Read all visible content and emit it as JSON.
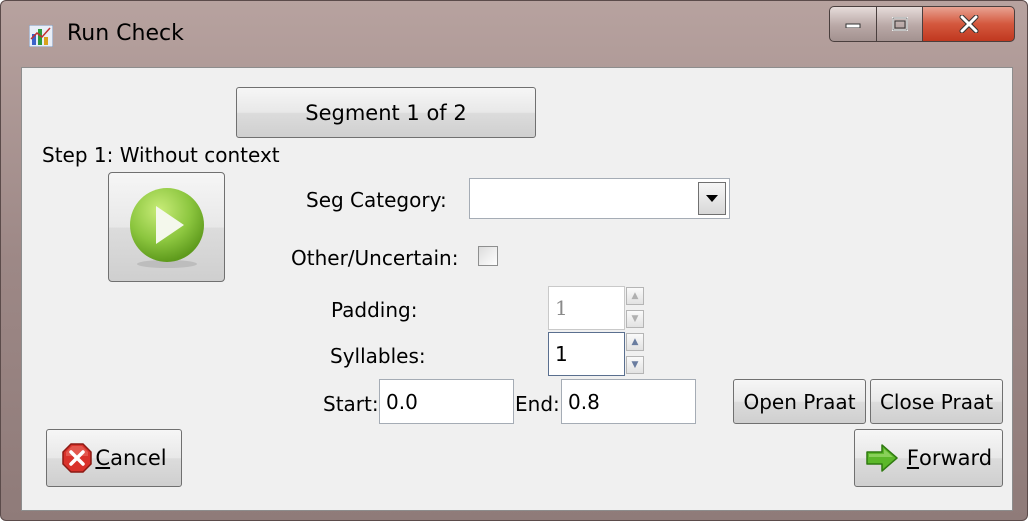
{
  "window": {
    "title": "Run Check"
  },
  "segment_button": {
    "label": "Segment 1 of 2"
  },
  "step_label": "Step 1: Without context",
  "form": {
    "seg_category_label": "Seg Category:",
    "seg_category_value": "",
    "other_uncertain_label": "Other/Uncertain:",
    "other_uncertain_checked": false,
    "padding_label": "Padding:",
    "padding_value": "1",
    "syllables_label": "Syllables:",
    "syllables_value": "1",
    "start_label": "Start:",
    "start_value": "0.0",
    "end_label": "End:",
    "end_value": "0.8"
  },
  "buttons": {
    "open_praat": "Open Praat",
    "close_praat": "Close Praat",
    "cancel_mnemonic": "C",
    "cancel_rest": "ancel",
    "forward_mnemonic": "F",
    "forward_rest": "orward"
  },
  "icons": {
    "app": "chart-app-icon",
    "play": "play-icon",
    "cancel": "cancel-x-icon",
    "forward": "green-arrow-right-icon",
    "dropdown": "chevron-down-icon",
    "minimize": "minimize-icon",
    "maximize": "maximize-icon",
    "close": "close-icon"
  },
  "colors": {
    "play_green": "#8cc63f",
    "cancel_red": "#d9322b",
    "forward_green": "#5cb82a"
  }
}
